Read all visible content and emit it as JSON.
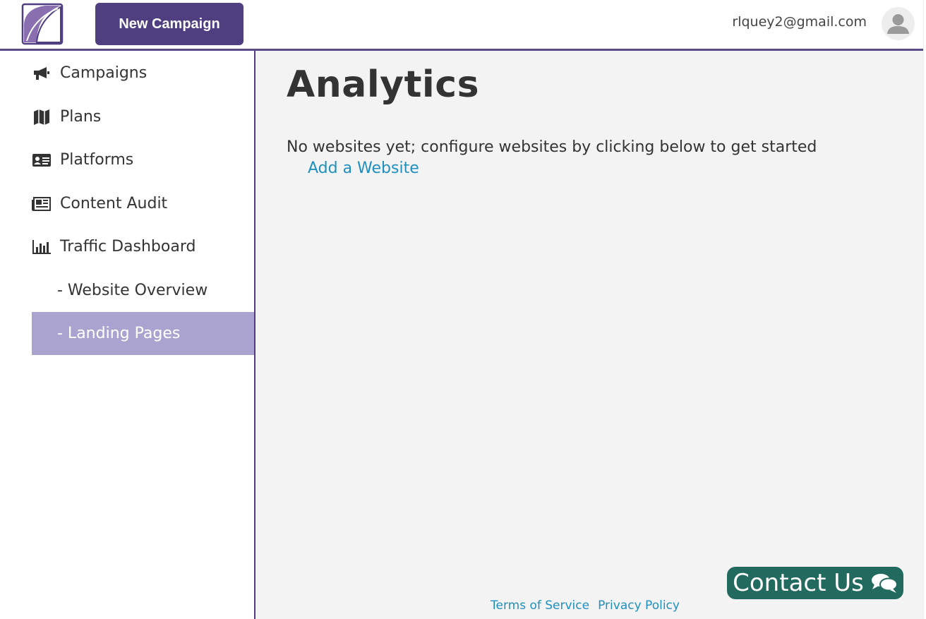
{
  "header": {
    "new_campaign_label": "New Campaign",
    "user_email": "rlquey2@gmail.com"
  },
  "sidebar": {
    "items": [
      {
        "label": "Campaigns",
        "icon": "megaphone-icon"
      },
      {
        "label": "Plans",
        "icon": "map-icon"
      },
      {
        "label": "Platforms",
        "icon": "id-card-icon"
      },
      {
        "label": "Content Audit",
        "icon": "newspaper-icon"
      },
      {
        "label": "Traffic Dashboard",
        "icon": "bar-chart-icon"
      },
      {
        "label": "- Website Overview"
      },
      {
        "label": "- Landing Pages",
        "active": true
      }
    ]
  },
  "main": {
    "title": "Analytics",
    "empty_message": "No websites yet; configure websites by clicking below to get started",
    "add_website_label": "Add a Website"
  },
  "footer": {
    "terms_label": "Terms of Service",
    "privacy_label": "Privacy Policy"
  },
  "contact": {
    "label": "Contact Us",
    "icon": "chat-bubbles-icon"
  },
  "colors": {
    "brand_purple": "#4f3f80",
    "active_nav": "#aba3cf",
    "link_blue": "#1f8fc0",
    "contact_green": "#236a5e"
  }
}
